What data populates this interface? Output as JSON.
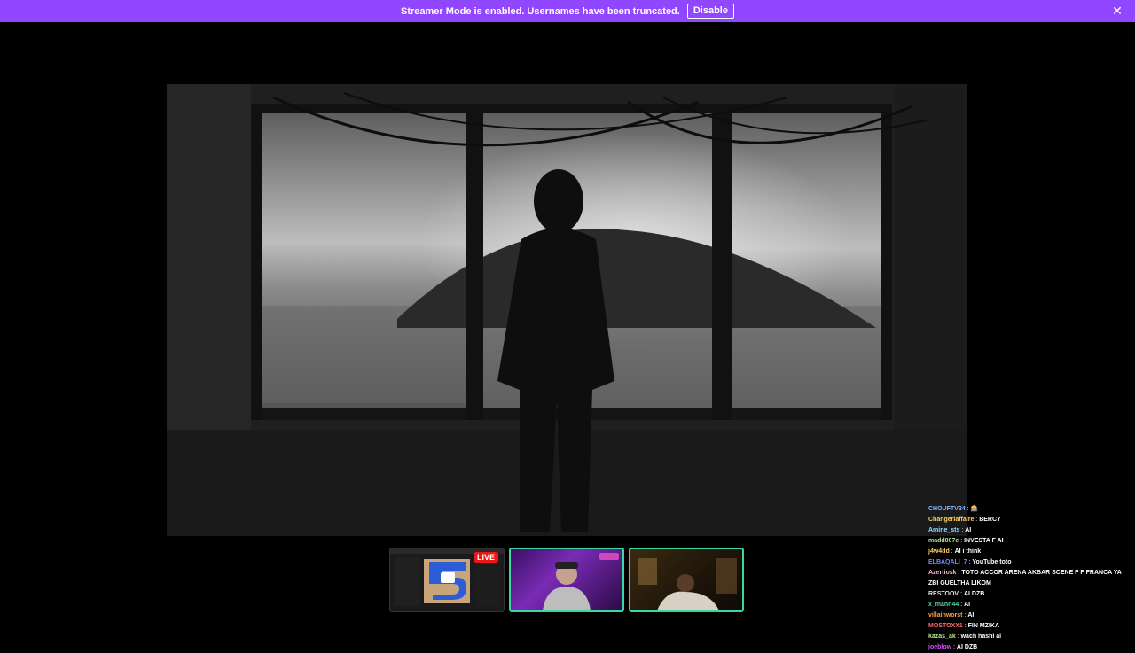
{
  "banner": {
    "message": "Streamer Mode is enabled. Usernames have been truncated.",
    "disable_label": "Disable",
    "close_icon": "✕"
  },
  "thumbnails": [
    {
      "name": "thumbnail-1",
      "live_label": "LIVE"
    },
    {
      "name": "thumbnail-2"
    },
    {
      "name": "thumbnail-3"
    }
  ],
  "chat": [
    {
      "user": "CHOUFTV24",
      "msg": "🎰",
      "color": "#8ab4ff"
    },
    {
      "user": "Changerlaffaire",
      "msg": "BERCY",
      "color": "#ffd166"
    },
    {
      "user": "Amine_sts",
      "msg": "AI",
      "color": "#9adcff"
    },
    {
      "user": "madd007e",
      "msg": "INVESTA F AI",
      "color": "#b5e48c"
    },
    {
      "user": "j4w4dd",
      "msg": "AI i think",
      "color": "#ffd166"
    },
    {
      "user": "ELBAQALI_7",
      "msg": "YouTube toto",
      "color": "#6a8dff"
    },
    {
      "user": "Azertiosk",
      "msg": "TOTO ACCOR ARENA AKBAR SCENE F F FRANCA YA ZBI GUELTHA LIKOM",
      "color": "#ffb3c6"
    },
    {
      "user": "RESTOOV",
      "msg": "AI DZB",
      "color": "#e0e0e0"
    },
    {
      "user": "x_mann44",
      "msg": "AI",
      "color": "#52d1a0"
    },
    {
      "user": "villainworst",
      "msg": "AI",
      "color": "#ff9f43"
    },
    {
      "user": "MOSTOXX1",
      "msg": "FIN MZIKA",
      "color": "#ff6b6b"
    },
    {
      "user": "kazas_ak",
      "msg": "wach hashi ai",
      "color": "#b5e48c"
    },
    {
      "user": "joeblow",
      "msg": "AI DZB",
      "color": "#d94fff"
    }
  ]
}
